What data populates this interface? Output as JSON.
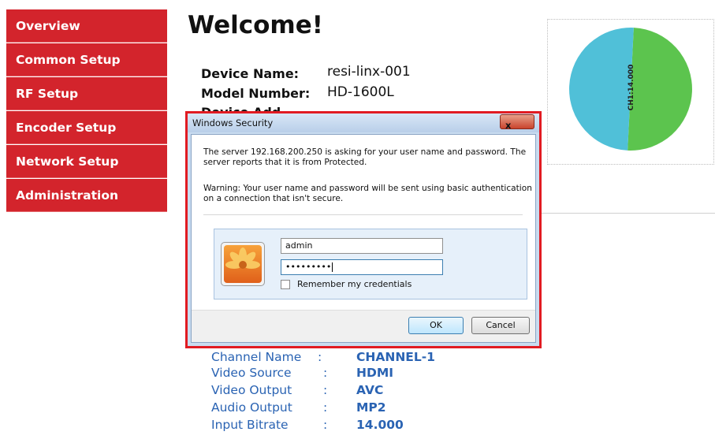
{
  "sidebar": {
    "items": [
      {
        "label": "Overview"
      },
      {
        "label": "Common Setup"
      },
      {
        "label": "RF Setup"
      },
      {
        "label": "Encoder Setup"
      },
      {
        "label": "Network Setup"
      },
      {
        "label": "Administration"
      }
    ]
  },
  "main": {
    "title": "Welcome!",
    "device_name_label": "Device Name:",
    "device_name_value": "resi-linx-001",
    "model_number_label": "Model Number:",
    "model_number_value": "HD-1600L",
    "device_address_label_partial": "Device Add"
  },
  "chart_data": {
    "type": "pie",
    "slice_labels": [
      "CH1:14.000"
    ],
    "colors": {
      "slice_1": "#5cc44e",
      "slice_2": "#50c0d8"
    },
    "values": [
      50,
      50
    ]
  },
  "channel": {
    "rows": [
      {
        "label": "Channel Name",
        "sep": ":",
        "value": "CHANNEL-1"
      },
      {
        "label": "Video Source",
        "sep": ":",
        "value": "HDMI"
      },
      {
        "label": "Video Output",
        "sep": ":",
        "value": "AVC"
      },
      {
        "label": "Audio Output",
        "sep": ":",
        "value": "MP2"
      },
      {
        "label": "Input Bitrate",
        "sep": ":",
        "value": "14.000"
      }
    ]
  },
  "dialog": {
    "title": "Windows Security",
    "close_label": "x",
    "message": "The server 192.168.200.250 is asking for your user name and password. The server reports that it is from Protected.",
    "warning": "Warning: Your user name and password will be sent using basic authentication on a connection that isn't secure.",
    "username_value": "admin",
    "password_value": "•••••••••",
    "remember_label": "Remember my credentials",
    "ok_label": "OK",
    "cancel_label": "Cancel"
  }
}
